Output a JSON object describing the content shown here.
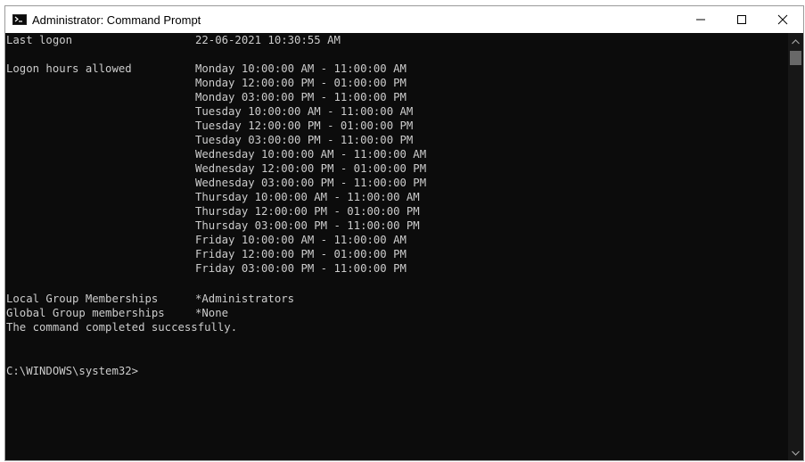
{
  "window": {
    "title": "Administrator: Command Prompt"
  },
  "console": {
    "last_logon_label": "Last logon",
    "last_logon_value": "22-06-2021 10:30:55 AM",
    "logon_hours_label": "Logon hours allowed",
    "logon_hours": [
      "Monday 10:00:00 AM - 11:00:00 AM",
      "Monday 12:00:00 PM - 01:00:00 PM",
      "Monday 03:00:00 PM - 11:00:00 PM",
      "Tuesday 10:00:00 AM - 11:00:00 AM",
      "Tuesday 12:00:00 PM - 01:00:00 PM",
      "Tuesday 03:00:00 PM - 11:00:00 PM",
      "Wednesday 10:00:00 AM - 11:00:00 AM",
      "Wednesday 12:00:00 PM - 01:00:00 PM",
      "Wednesday 03:00:00 PM - 11:00:00 PM",
      "Thursday 10:00:00 AM - 11:00:00 AM",
      "Thursday 12:00:00 PM - 01:00:00 PM",
      "Thursday 03:00:00 PM - 11:00:00 PM",
      "Friday 10:00:00 AM - 11:00:00 AM",
      "Friday 12:00:00 PM - 01:00:00 PM",
      "Friday 03:00:00 PM - 11:00:00 PM"
    ],
    "local_groups_label": "Local Group Memberships",
    "local_groups_value": "*Administrators",
    "global_groups_label": "Global Group memberships",
    "global_groups_value": "*None",
    "completion_message": "The command completed successfully.",
    "prompt": "C:\\WINDOWS\\system32>"
  },
  "colors": {
    "console_background": "#0c0c0c",
    "console_text": "#cccccc",
    "titlebar_background": "#ffffff"
  },
  "icons": {
    "app": "cmd-icon",
    "minimize": "minimize-icon",
    "maximize": "maximize-icon",
    "close": "close-icon",
    "scroll_up": "chevron-up-icon",
    "scroll_down": "chevron-down-icon"
  }
}
